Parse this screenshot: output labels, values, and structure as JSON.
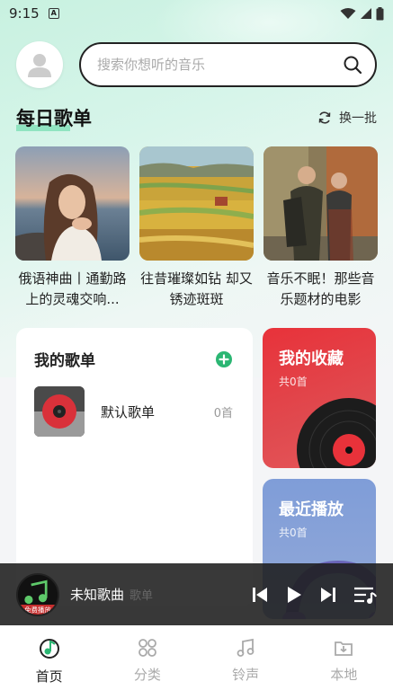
{
  "status_bar": {
    "time": "9:15",
    "notif_letter": "A"
  },
  "search": {
    "placeholder": "搜索你想听的音乐"
  },
  "daily": {
    "title": "每日歌单",
    "refresh_label": "换一批",
    "playlists": [
      {
        "title": "俄语神曲丨通勤路上的灵魂交响..."
      },
      {
        "title": "往昔璀璨如钻 却又锈迹斑斑"
      },
      {
        "title": "音乐不眠！那些音乐题材的电影"
      }
    ]
  },
  "my_playlists": {
    "title": "我的歌单",
    "items": [
      {
        "name": "默认歌单",
        "count": "0首"
      }
    ],
    "footer_partial": "歌单"
  },
  "favorites": {
    "title": "我的收藏",
    "count": "共0首"
  },
  "recent": {
    "title": "最近播放",
    "count": "共0首"
  },
  "player": {
    "song": "未知歌曲",
    "badge_text": "免费播放"
  },
  "tabs": [
    {
      "label": "首页",
      "icon": "home-music-icon",
      "active": true
    },
    {
      "label": "分类",
      "icon": "category-grid-icon",
      "active": false
    },
    {
      "label": "铃声",
      "icon": "ringtone-note-icon",
      "active": false
    },
    {
      "label": "本地",
      "icon": "local-folder-icon",
      "active": false
    }
  ],
  "colors": {
    "accent_green": "#2bb673",
    "favorites_red": "#e8323a",
    "recent_blue": "#8ba4d8"
  }
}
